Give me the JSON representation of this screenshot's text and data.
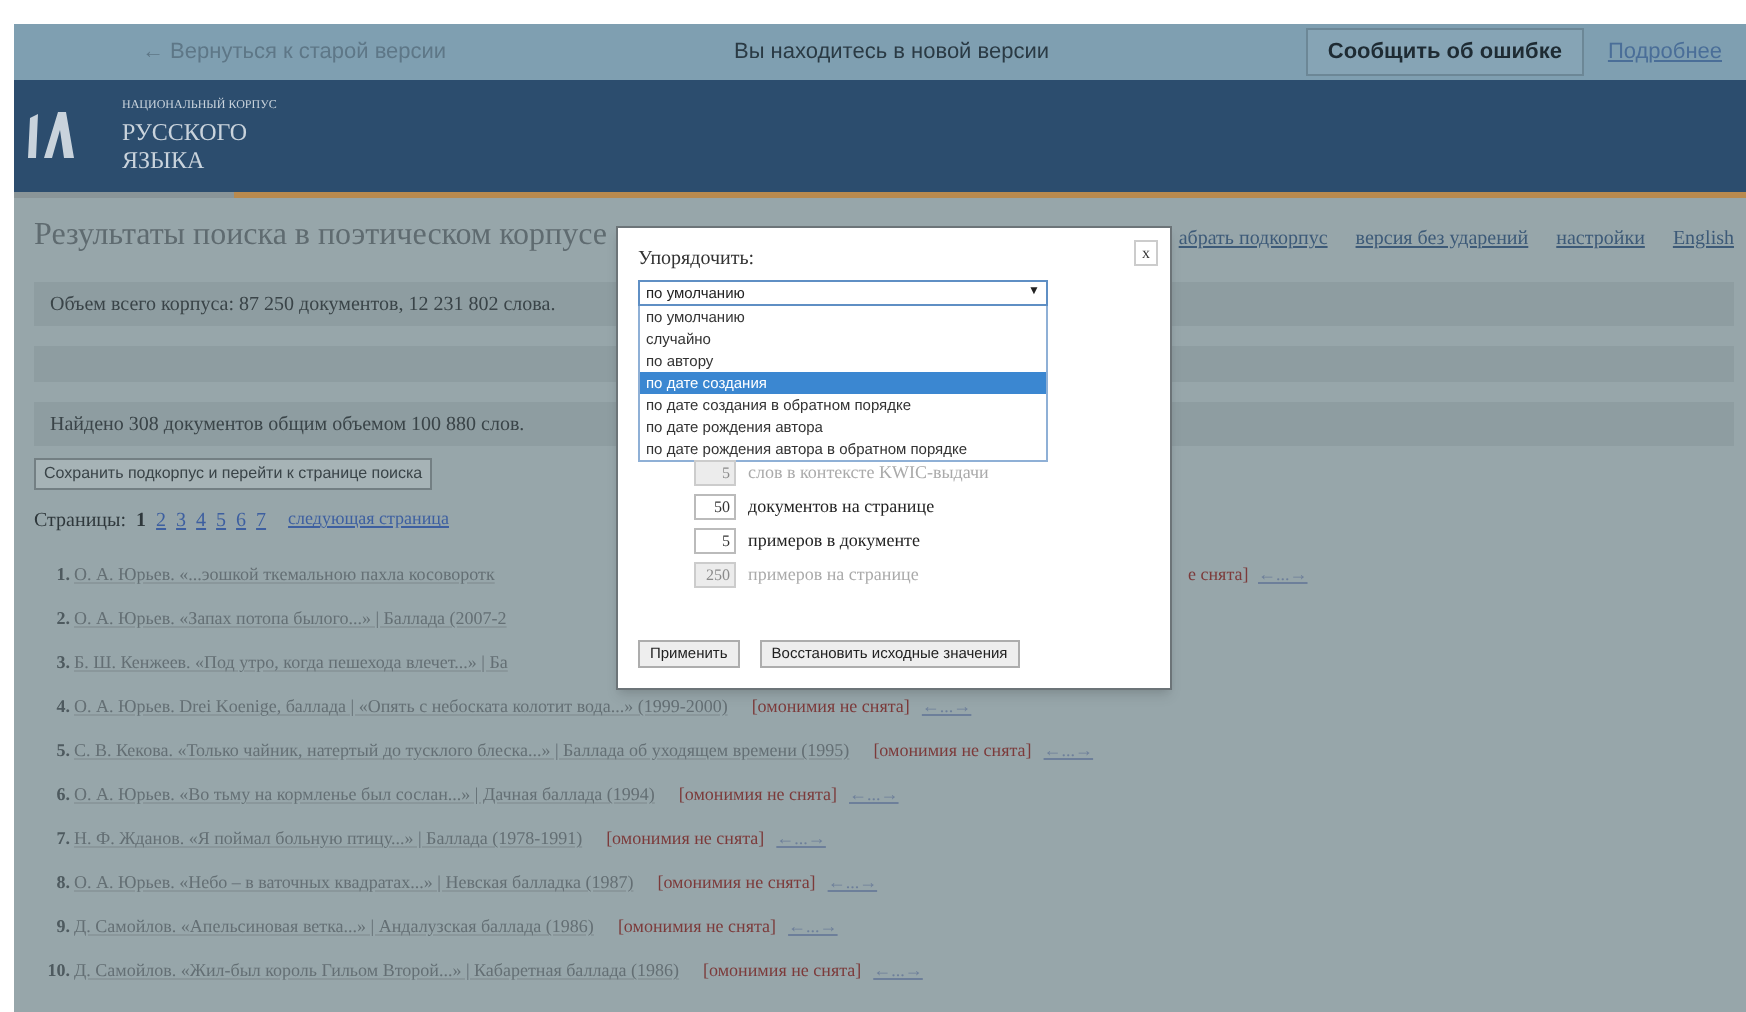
{
  "top_bar": {
    "back_link": "← Вернуться к старой версии",
    "notice": "Вы находитесь в новой версии",
    "report_button": "Сообщить об ошибке",
    "more_link": "Подробнее"
  },
  "logo": {
    "line_1": "НАЦИОНАЛЬНЫЙ КОРПУС",
    "line_2": "РУССКОГО",
    "line_3": "ЯЗЫКА"
  },
  "page_title": "Результаты поиска в поэтическом корпусе",
  "header_links": [
    "абрать подкорпус",
    "версия без ударений",
    "настройки",
    "English"
  ],
  "corpus_info": "Объем всего корпуса: 87 250 документов, 12 231 802 слова.",
  "found_info": "Найдено 308 документов общим объемом 100 880 слов.",
  "save_button": "Сохранить подкорпус и перейти к странице поиска",
  "pages": {
    "label": "Страницы:",
    "items": [
      {
        "label": "1",
        "selected": true
      },
      {
        "label": "2",
        "selected": false
      },
      {
        "label": "3",
        "selected": false
      },
      {
        "label": "4",
        "selected": false
      },
      {
        "label": "5",
        "selected": false
      },
      {
        "label": "6",
        "selected": false
      },
      {
        "label": "7",
        "selected": false
      }
    ],
    "next": "следующая страница"
  },
  "results": [
    {
      "number": "1.",
      "text": "О. А. Юрьев. «...эошкой ткемальною пахла косоворотк",
      "tail": "е снята]",
      "nav": "←...→"
    },
    {
      "number": "2.",
      "text": "О. А. Юрьев. «Запах потопа былого...» | Баллада (2007-2"
    },
    {
      "number": "3.",
      "text": "Б. Ш. Кенжеев. «Под утро, когда пешехода влечет...» | Ба"
    },
    {
      "number": "4.",
      "text": "О. А. Юрьев. Drei Koenige, баллада | «Опять с небоската колотит вода...» (1999-2000)",
      "note": "[омонимия не снята]",
      "nav": "←...→"
    },
    {
      "number": "5.",
      "text": "С. В. Кекова. «Только чайник, натертый до тусклого блеска...» | Баллада об уходящем времени (1995)",
      "note": "[омонимия не снята]",
      "nav": "←...→"
    },
    {
      "number": "6.",
      "text": "О. А. Юрьев. «Во тьму на кормленье был сослан...» | Дачная баллада (1994)",
      "note": "[омонимия не снята]",
      "nav": "←...→"
    },
    {
      "number": "7.",
      "text": "Н. Ф. Жданов. «Я поймал больную птицу...» | Баллада (1978-1991)",
      "note": "[омонимия не снята]",
      "nav": "←...→"
    },
    {
      "number": "8.",
      "text": "О. А. Юрьев. «Небо – в ваточных квадратах...» | Невская балладка (1987)",
      "note": "[омонимия не снята]",
      "nav": "←...→"
    },
    {
      "number": "9.",
      "text": "Д. Самойлов. «Апельсиновая ветка...» | Андалузская баллада (1986)",
      "note": "[омонимия не снята]",
      "nav": "←...→"
    },
    {
      "number": "10.",
      "text": "Д. Самойлов. «Жил-был король Гильом Второй...» | Кабаретная баллада (1986)",
      "note": "[омонимия не снята]",
      "nav": "←...→"
    }
  ],
  "dialog": {
    "title": "Упорядочить:",
    "close": "x",
    "select": {
      "value": "по умолчанию",
      "arrow": "▼",
      "expanded": true,
      "options": [
        {
          "label": "по умолчанию",
          "highlighted": false
        },
        {
          "label": "случайно",
          "highlighted": false
        },
        {
          "label": "по автору",
          "highlighted": false
        },
        {
          "label": "по дате создания",
          "highlighted": true
        },
        {
          "label": "по дате создания в обратном порядке",
          "highlighted": false
        },
        {
          "label": "по дате рождения автора",
          "highlighted": false
        },
        {
          "label": "по дате рождения автора в обратном порядке",
          "highlighted": false
        }
      ]
    },
    "fields": [
      {
        "value": "5",
        "label": "слов в контексте KWIC-выдачи",
        "disabled": true
      },
      {
        "value": "50",
        "label": "документов на странице",
        "disabled": false
      },
      {
        "value": "5",
        "label": "примеров в документе",
        "disabled": false
      },
      {
        "value": "250",
        "label": "примеров на странице",
        "disabled": true
      }
    ],
    "buttons": [
      "Применить",
      "Восстановить исходные значения"
    ]
  }
}
